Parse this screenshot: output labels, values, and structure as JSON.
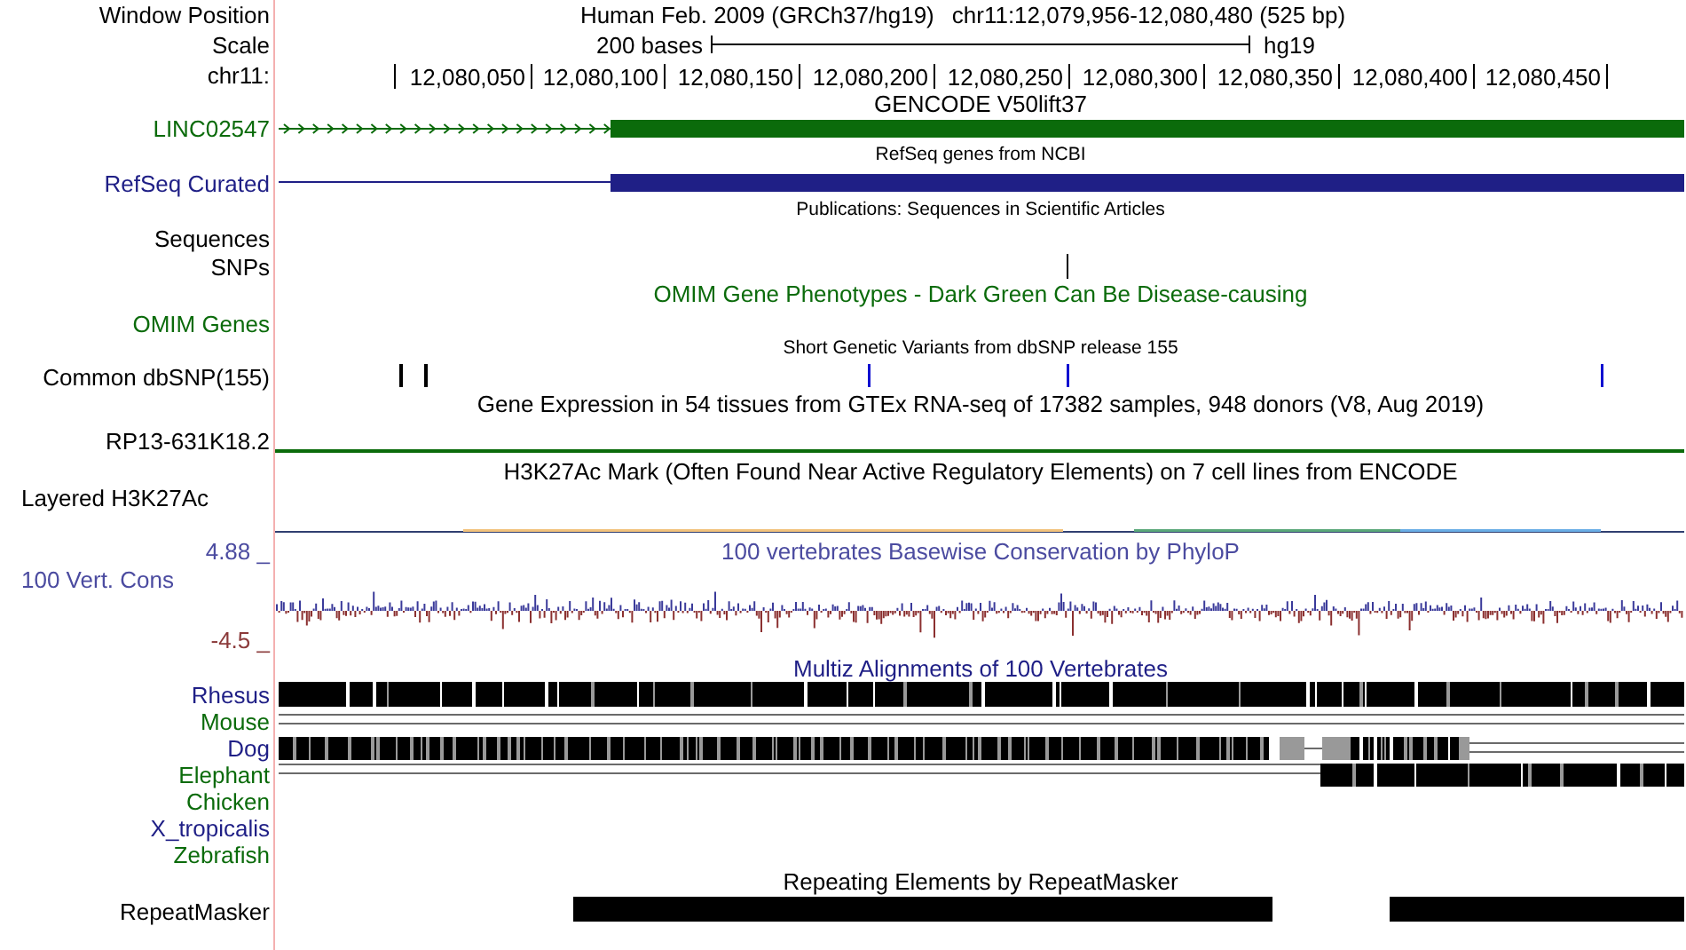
{
  "header": {
    "position_label": "Window Position",
    "assembly": "Human Feb. 2009 (GRCh37/hg19)",
    "position": "chr11:12,079,956-12,080,480 (525 bp)",
    "scale_label": "Scale",
    "scale_length": "200 bases",
    "scale_assembly": "hg19",
    "chrom_label": "chr11:",
    "ruler_labels": [
      "12,080,050",
      "12,080,100",
      "12,080,150",
      "12,080,200",
      "12,080,250",
      "12,080,300",
      "12,080,350",
      "12,080,400",
      "12,080,450"
    ]
  },
  "tracks": [
    {
      "kind": "gencode",
      "title": "GENCODE V50lift37",
      "label": "LINC02547",
      "color": "#0b6b0b"
    },
    {
      "kind": "refseq",
      "title": "RefSeq genes from NCBI",
      "label": "RefSeq Curated",
      "color": "#1f1f86"
    },
    {
      "kind": "publications",
      "title": "Publications: Sequences in Scientific Articles",
      "labels": [
        "Sequences",
        "SNPs"
      ],
      "color": "#000000"
    },
    {
      "kind": "omim",
      "title": "OMIM Gene Phenotypes - Dark Green Can Be Disease-causing",
      "label": "OMIM Genes",
      "color": "#0b6b0b"
    },
    {
      "kind": "dbsnp",
      "title": "Short Genetic Variants from dbSNP release 155",
      "label": "Common dbSNP(155)",
      "color": "#000000"
    },
    {
      "kind": "gtex",
      "title": "Gene Expression in 54 tissues from GTEx RNA-seq of 17382 samples, 948 donors (V8, Aug 2019)",
      "label": "RP13-631K18.2",
      "color": "#000000"
    },
    {
      "kind": "h3k27ac",
      "title": "H3K27Ac Mark (Often Found Near Active Regulatory Elements) on 7 cell lines from ENCODE",
      "label": "Layered H3K27Ac",
      "color": "#000000"
    },
    {
      "kind": "phylop",
      "title": "100 vertebrates Basewise Conservation by PhyloP",
      "label": "100 Vert. Cons",
      "max_label": "4.88 _",
      "min_label": "-4.5 _",
      "color": "#4b4ba0"
    },
    {
      "kind": "multiz",
      "title": "Multiz Alignments of 100 Vertebrates",
      "species": [
        {
          "name": "Rhesus",
          "color": "#1f1f86"
        },
        {
          "name": "Mouse",
          "color": "#0b6b0b"
        },
        {
          "name": "Dog",
          "color": "#1f1f86"
        },
        {
          "name": "Elephant",
          "color": "#0b6b0b"
        },
        {
          "name": "Chicken",
          "color": "#0b6b0b"
        },
        {
          "name": "X_tropicalis",
          "color": "#1f1f86"
        },
        {
          "name": "Zebrafish",
          "color": "#0b6b0b"
        }
      ]
    },
    {
      "kind": "rmsk",
      "title": "Repeating Elements by RepeatMasker",
      "label": "RepeatMasker",
      "color": "#000000"
    }
  ]
}
